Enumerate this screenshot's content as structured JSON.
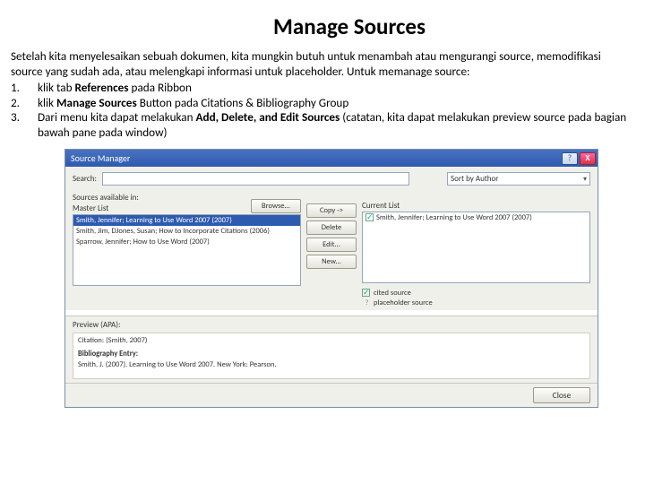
{
  "title": "Manage Sources",
  "intro": "Setelah kita menyelesaikan sebuah dokumen, kita mungkin butuh untuk menambah atau mengurangi source, memodifikasi source yang sudah ada, atau melengkapi informasi untuk placeholder. Untuk memanage source:",
  "steps": [
    {
      "n": "1.",
      "pre": "klik tab ",
      "b": "References",
      "post": "  pada Ribbon"
    },
    {
      "n": "2.",
      "pre": "klik  ",
      "b": "Manage Sources",
      "post": " Button pada Citations & Bibliography Group"
    },
    {
      "n": "3.",
      "pre": "Dari menu kita dapat melakukan  ",
      "b": "Add, Delete, and Edit Sources",
      "post": " (catatan, kita dapat melakukan preview source pada bagian bawah pane pada window)"
    }
  ],
  "dialog": {
    "title": "Source Manager",
    "search_label": "Search:",
    "sort_label": "Sort by Author",
    "master_label": "Sources available in:",
    "master_sub": "Master List",
    "browse_btn": "Browse...",
    "master_items": [
      "Smith, Jennifer; Learning to Use Word 2007 (2007)",
      "Smith, Jim, DJones, Susan; How to Incorporate Citations (2006)",
      "Sparrow, Jennifer; How to Use Word (2007)"
    ],
    "mid_buttons": [
      "Copy ->",
      "Delete",
      "Edit...",
      "New..."
    ],
    "current_label": "Current List",
    "current_items": [
      "Smith, Jennifer; Learning to Use Word 2007 (2007)"
    ],
    "legend_cited": "cited source",
    "legend_ph": "placeholder source",
    "preview_label": "Preview (APA):",
    "preview_citation_h": "Citation: (Smith, 2007)",
    "preview_bib_h": "Bibliography Entry:",
    "preview_bib_t": "Smith, J. (2007). Learning to Use Word 2007. New York: Pearson.",
    "close_btn": "Close"
  }
}
